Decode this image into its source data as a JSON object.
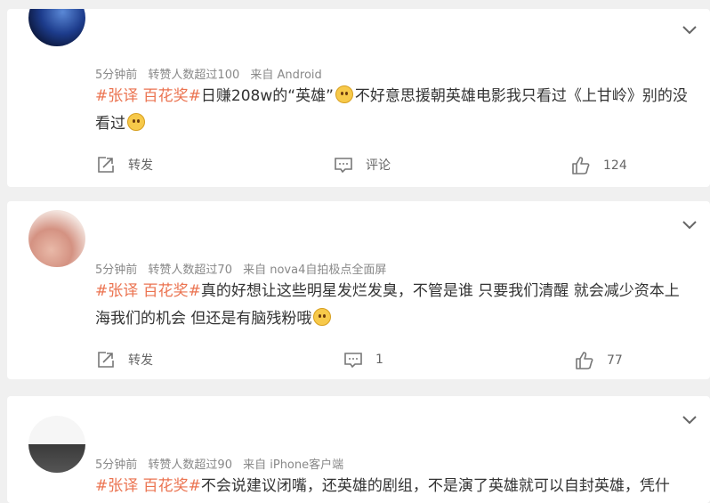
{
  "posts": [
    {
      "meta": {
        "time": "5分钟前",
        "reposts": "转赞人数超过100",
        "source": "来自 Android"
      },
      "tag": "#张译 百花奖#",
      "text": "日赚208w的“英雄”",
      "text2": "不好意思援朝英雄电影我只看过《上甘岭》别的没看过",
      "actions": {
        "repost": "转发",
        "comment": "评论",
        "likes": "124"
      }
    },
    {
      "meta": {
        "time": "5分钟前",
        "reposts": "转赞人数超过70",
        "source": "来自 nova4自拍极点全面屏"
      },
      "tag": "#张译 百花奖#",
      "text": "真的好想让这些明星发烂发臭，不管是谁 只要我们清醒 就会减少资本上海我们的机会 但还是有脑残粉哦",
      "actions": {
        "repost": "转发",
        "comment": "1",
        "likes": "77"
      }
    },
    {
      "meta": {
        "time": "5分钟前",
        "reposts": "转赞人数超过90",
        "source": "来自 iPhone客户端"
      },
      "tag": "#张译 百花奖#",
      "text": "不会说建议闭嘴，还英雄的剧组，不是演了英雄就可以自封英雄，凭什"
    }
  ],
  "icons": {
    "chevron": "chevron-down-icon",
    "repost": "repost-icon",
    "comment": "comment-icon",
    "like": "thumbs-up-icon",
    "emoji": "emoji-icon"
  },
  "colors": {
    "tag": "#eb7350",
    "meta": "#888888",
    "background": "#f0f0f0"
  }
}
